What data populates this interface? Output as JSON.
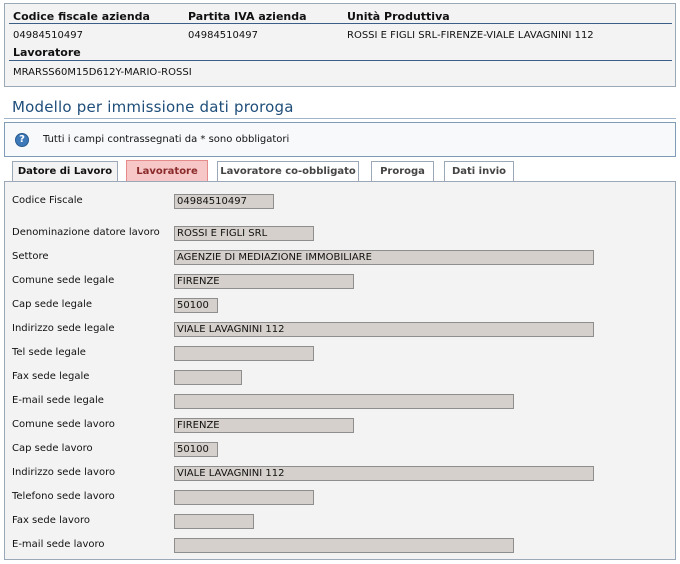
{
  "summary": {
    "h_codice_fiscale": "Codice fiscale azienda",
    "h_partita_iva": "Partita IVA azienda",
    "h_unita": "Unità Produttiva",
    "codice_fiscale": "04984510497",
    "partita_iva": "04984510497",
    "unita": "ROSSI E FIGLI SRL-FIRENZE-VIALE LAVAGNINI 112",
    "h_lavoratore": "Lavoratore",
    "lavoratore": "MRARSS60M15D612Y-MARIO-ROSSI"
  },
  "page_title": "Modello per immissione dati proroga",
  "info": {
    "icon": "help-icon",
    "text": "Tutti i campi contrassegnati da * sono obbligatori"
  },
  "tabs": [
    {
      "label": "Datore di Lavoro",
      "active": true
    },
    {
      "label": "Lavoratore",
      "highlighted": true
    },
    {
      "label": "Lavoratore co-obbligato"
    },
    {
      "label": "Proroga"
    },
    {
      "label": "Dati invio"
    }
  ],
  "fields": [
    {
      "label": "Codice Fiscale",
      "value": "04984510497"
    },
    {
      "label": "Denominazione datore lavoro",
      "value": "ROSSI E FIGLI SRL"
    },
    {
      "label": "Settore",
      "value": "AGENZIE DI MEDIAZIONE IMMOBILIARE"
    },
    {
      "label": "Comune sede legale",
      "value": "FIRENZE"
    },
    {
      "label": "Cap sede legale",
      "value": "50100"
    },
    {
      "label": "Indirizzo sede legale",
      "value": "VIALE LAVAGNINI 112"
    },
    {
      "label": "Tel sede legale",
      "value": ""
    },
    {
      "label": "Fax sede legale",
      "value": ""
    },
    {
      "label": "E-mail sede legale",
      "value": ""
    },
    {
      "label": "Comune sede lavoro",
      "value": "FIRENZE"
    },
    {
      "label": "Cap sede lavoro",
      "value": "50100"
    },
    {
      "label": "Indirizzo sede lavoro",
      "value": "VIALE LAVAGNINI 112"
    },
    {
      "label": "Telefono sede lavoro",
      "value": ""
    },
    {
      "label": "Fax sede lavoro",
      "value": ""
    },
    {
      "label": "E-mail sede lavoro",
      "value": ""
    }
  ],
  "colors": {
    "title": "#1f4e7a",
    "highlight_tab": "#f7c6c6",
    "field_bg": "#d5d0cb",
    "panel_bg": "#f3f3f3"
  }
}
